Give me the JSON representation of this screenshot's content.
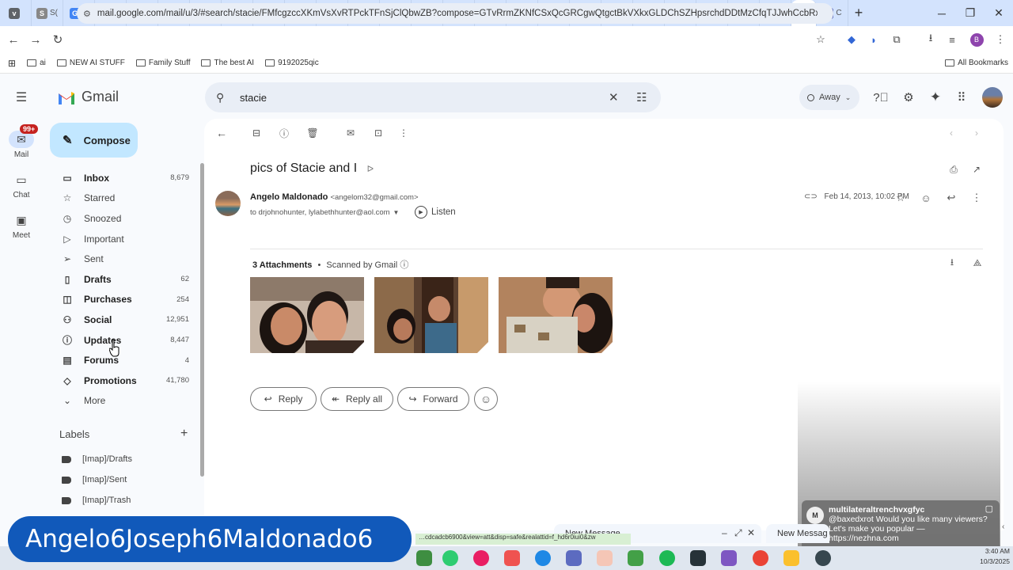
{
  "browser": {
    "tabs": [
      {
        "icon": "chrome-menu-icon",
        "color": "#5f6368",
        "glyph": "v",
        "title": ""
      },
      {
        "icon": "site-icon",
        "color": "#888",
        "glyph": "S",
        "title": "S("
      },
      {
        "icon": "google-icon",
        "color": "#4285f4",
        "glyph": "G",
        "title": "Y"
      },
      {
        "icon": "x-icon",
        "color": "#111",
        "glyph": "X",
        "title": "C"
      },
      {
        "icon": "x-icon",
        "color": "#111",
        "glyph": "X",
        "title": "C"
      },
      {
        "icon": "x-icon",
        "color": "#111",
        "glyph": "X",
        "title": "A"
      },
      {
        "icon": "x-icon",
        "color": "#111",
        "glyph": "X",
        "title": "C"
      },
      {
        "icon": "x-icon",
        "color": "#111",
        "glyph": "X",
        "title": "F"
      },
      {
        "icon": "google-icon",
        "color": "#4285f4",
        "glyph": "G",
        "title": "e"
      },
      {
        "icon": "e-icon",
        "color": "#222",
        "glyph": "E",
        "title": "E"
      },
      {
        "icon": "instagram-icon",
        "color": "#d6249f",
        "glyph": "◎",
        "title": "("
      },
      {
        "icon": "soundcloud-icon",
        "color": "#f50",
        "glyph": "☁",
        "title": "S"
      },
      {
        "icon": "google-icon",
        "color": "#4285f4",
        "glyph": "G",
        "title": "n"
      },
      {
        "icon": "gmail-icon",
        "color": "#d93025",
        "glyph": "M",
        "title": "b"
      },
      {
        "icon": "facebook-icon",
        "color": "#1877f2",
        "glyph": "f",
        "title": "("
      },
      {
        "icon": "facebook-icon",
        "color": "#1877f2",
        "glyph": "f",
        "title": "F"
      },
      {
        "icon": "gmail-icon",
        "color": "#d93025",
        "glyph": "M",
        "title": "I"
      },
      {
        "icon": "gmail-icon",
        "color": "#d93025",
        "glyph": "M",
        "title": "Y"
      },
      {
        "icon": "youtube-icon",
        "color": "#f00",
        "glyph": "▶",
        "title": "("
      },
      {
        "icon": "youtube-icon",
        "color": "#f00",
        "glyph": "▶",
        "title": "("
      },
      {
        "icon": "gmail-icon",
        "color": "#d93025",
        "glyph": "M",
        "title": "I"
      },
      {
        "icon": "gmail-icon",
        "color": "#d93025",
        "glyph": "M",
        "title": "I"
      },
      {
        "icon": "gmail-icon",
        "color": "#d93025",
        "glyph": "M",
        "title": "I"
      },
      {
        "icon": "google-icon",
        "color": "#4285f4",
        "glyph": "G",
        "title": "E"
      },
      {
        "icon": "n-icon",
        "color": "#222",
        "glyph": "N",
        "title": "V"
      }
    ],
    "active_tab_title": "p",
    "other_tab_title": "C",
    "url": "mail.google.com/mail/u/3/#search/stacie/FMfcgzccXKmVsXvRTPckTFnSjClQbwZB?compose=GTvRrmZKNfCSxQcGRCgwQtgctBkVXkxGLDChSZHpsrchdDDtMzCfqTJJwhCcbRxkZnVlf...",
    "bookmarks": [
      "ai",
      "NEW AI STUFF",
      "Family Stuff",
      "The best AI",
      "9192025qic"
    ],
    "all_bookmarks": "All Bookmarks"
  },
  "rail": {
    "mail_badge": "99+",
    "mail": "Mail",
    "chat": "Chat",
    "meet": "Meet"
  },
  "app": {
    "name": "Gmail",
    "compose": "Compose",
    "search_query": "stacie",
    "status": "Away"
  },
  "nav": [
    {
      "label": "Inbox",
      "count": "8,679",
      "icon": "inbox-icon",
      "glyph": "▭",
      "bold": true
    },
    {
      "label": "Starred",
      "count": "",
      "icon": "star-icon",
      "glyph": "☆",
      "bold": false
    },
    {
      "label": "Snoozed",
      "count": "",
      "icon": "clock-icon",
      "glyph": "◷",
      "bold": false
    },
    {
      "label": "Important",
      "count": "",
      "icon": "important-icon",
      "glyph": "▷",
      "bold": false
    },
    {
      "label": "Sent",
      "count": "",
      "icon": "send-icon",
      "glyph": "➢",
      "bold": false
    },
    {
      "label": "Drafts",
      "count": "62",
      "icon": "draft-icon",
      "glyph": "▯",
      "bold": true
    },
    {
      "label": "Purchases",
      "count": "254",
      "icon": "purchases-icon",
      "glyph": "◫",
      "bold": true
    },
    {
      "label": "Social",
      "count": "12,951",
      "icon": "social-icon",
      "glyph": "⚇",
      "bold": true
    },
    {
      "label": "Updates",
      "count": "8,447",
      "icon": "info-icon",
      "glyph": "ⓘ",
      "bold": true
    },
    {
      "label": "Forums",
      "count": "4",
      "icon": "forum-icon",
      "glyph": "▤",
      "bold": true
    },
    {
      "label": "Promotions",
      "count": "41,780",
      "icon": "tag-icon",
      "glyph": "◇",
      "bold": true
    },
    {
      "label": "More",
      "count": "",
      "icon": "chevron-down-icon",
      "glyph": "⌄",
      "bold": false
    }
  ],
  "labels": {
    "heading": "Labels",
    "items": [
      "[Imap]/Drafts",
      "[Imap]/Sent",
      "[Imap]/Trash"
    ]
  },
  "email": {
    "subject": "pics of Stacie and I",
    "sender_name": "Angelo Maldonado",
    "sender_email": "<angelom32@gmail.com>",
    "recipients": "to drjohnohunter, lylabethhunter@aol.com",
    "listen": "Listen",
    "date": "Feb 14, 2013, 10:02 PM",
    "attachments_count": "3 Attachments",
    "scanned": "Scanned by Gmail",
    "reply": "Reply",
    "reply_all": "Reply all",
    "forward": "Forward"
  },
  "notification": {
    "avatar": "M",
    "username": "multilateraltrenchvxgfyc",
    "message": "@baxedxrot Would you like many viewers? Let's make you popular — https://nezhna.com"
  },
  "compose_windows": {
    "new_message": "New Message",
    "new_message_2": "New Messag"
  },
  "status_link": "…cdcadcb6900&view=att&disp=safe&realattid=f_hd6r0iui0&zw",
  "clock": {
    "time": "3:40 AM",
    "date": "10/3/2025"
  },
  "overlay_name": "Angelo6Joseph6Maldonado6"
}
